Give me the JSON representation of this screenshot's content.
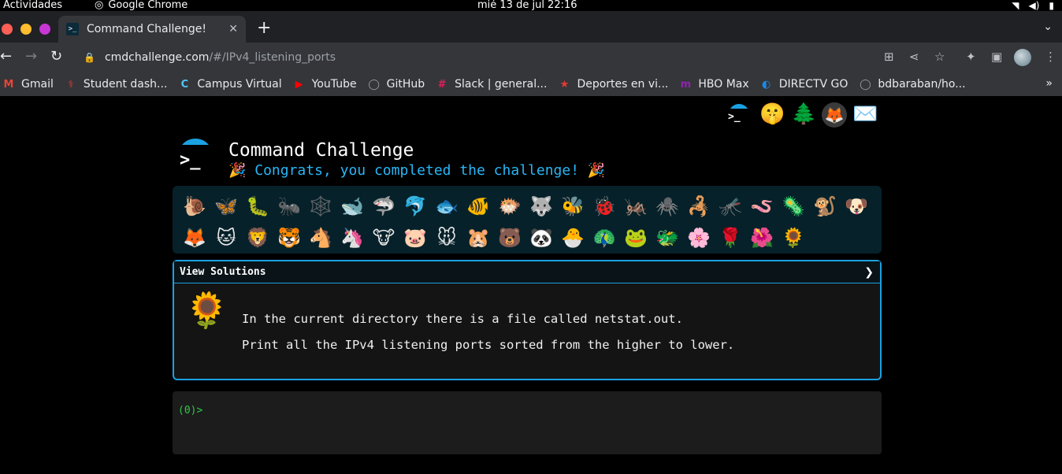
{
  "system": {
    "activities": "Actividades",
    "app_name": "Google Chrome",
    "clock": "mié 13 de jul  22:16"
  },
  "browser": {
    "tab_title": "Command Challenge!",
    "url_host": "cmdchallenge.com",
    "url_path": "/#/IPv4_listening_ports",
    "bookmarks": [
      {
        "label": "Gmail",
        "icon": "gmail-icon",
        "color": "#ea4335",
        "glyph": "M"
      },
      {
        "label": "Student dash...",
        "icon": "student-dashboard-icon",
        "color": "#e53935",
        "glyph": "⚕"
      },
      {
        "label": "Campus Virtual",
        "icon": "campus-virtual-icon",
        "color": "#4fc3f7",
        "glyph": "C"
      },
      {
        "label": "YouTube",
        "icon": "youtube-icon",
        "color": "#ff0000",
        "glyph": "▶"
      },
      {
        "label": "GitHub",
        "icon": "github-icon",
        "color": "#9e9e9e",
        "glyph": "◯"
      },
      {
        "label": "Slack | general...",
        "icon": "slack-icon",
        "color": "#e01e5a",
        "glyph": "#"
      },
      {
        "label": "Deportes en vi...",
        "icon": "deportes-icon",
        "color": "#e53935",
        "glyph": "★"
      },
      {
        "label": "HBO Max",
        "icon": "hbo-max-icon",
        "color": "#8e24aa",
        "glyph": "m"
      },
      {
        "label": "DIRECTV GO",
        "icon": "directv-icon",
        "color": "#1e88e5",
        "glyph": "◐"
      },
      {
        "label": "bdbaraban/ho...",
        "icon": "github-repo-icon",
        "color": "#9e9e9e",
        "glyph": "◯"
      }
    ]
  },
  "header": {
    "title": "Command Challenge",
    "congrats": "🎉 Congrats, you completed the challenge! 🎉"
  },
  "social_links": [
    {
      "icon": "cmdchallenge-icon",
      "glyph": "🖥"
    },
    {
      "icon": "shush-emoji-icon",
      "glyph": "🤫"
    },
    {
      "icon": "tree-icon",
      "glyph": "🌲"
    },
    {
      "icon": "gitlab-icon",
      "glyph": "🦊"
    },
    {
      "icon": "email-icon",
      "glyph": "✉️"
    }
  ],
  "animals": [
    "🐌",
    "🦋",
    "🐛",
    "🐜",
    "🕸️",
    "🐋",
    "🦈",
    "🐬",
    "🐟",
    "🐠",
    "🐡",
    "🐺",
    "🐝",
    "🐞",
    "🦗",
    "🕷️",
    "🦂",
    "🦟",
    "🪱",
    "🦠",
    "🐒",
    "🐶",
    "🦊",
    "🐱",
    "🦁",
    "🐯",
    "🐴",
    "🦄",
    "🐮",
    "🐷",
    "🐭",
    "🐹",
    "🐻",
    "🐼",
    "🐣",
    "🦚",
    "🐸",
    "🐲",
    "🌸",
    "🌹",
    "🌺",
    "🌻"
  ],
  "panel": {
    "view_solutions": "View Solutions",
    "arrow": "❯",
    "flower": "🌻",
    "line1": "In the current directory there is a file called netstat.out.",
    "line2": "Print all the IPv4 listening ports sorted from the higher to lower."
  },
  "terminal": {
    "prompt": "(0)>"
  }
}
